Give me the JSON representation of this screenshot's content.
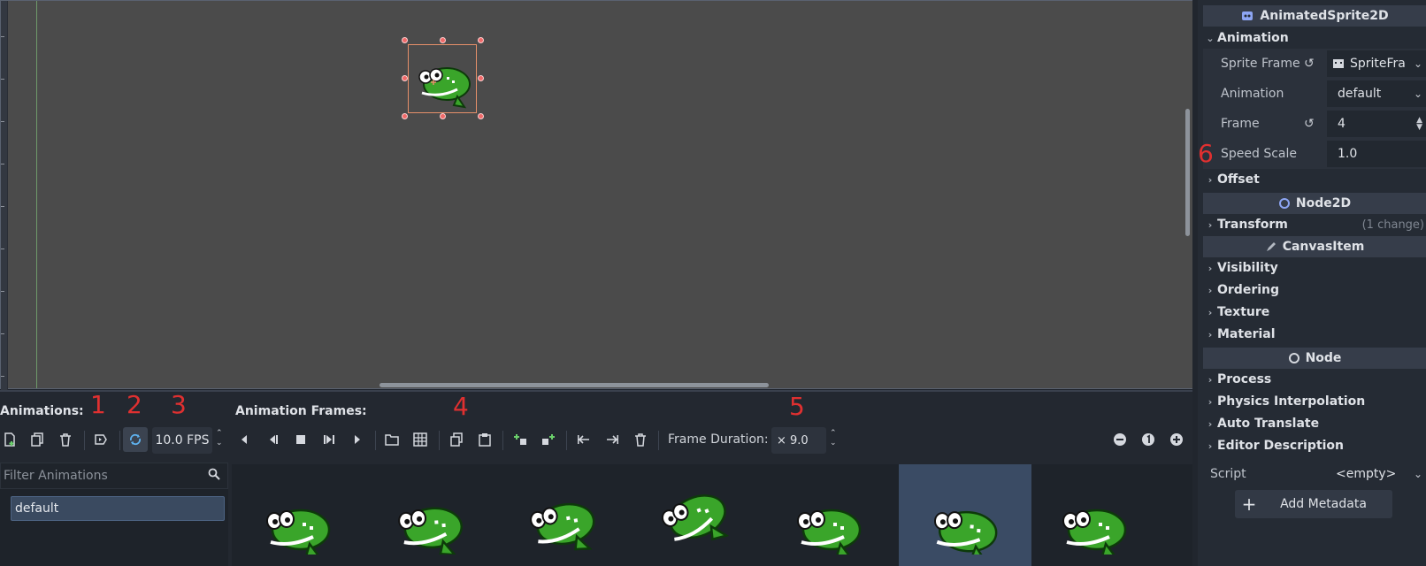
{
  "inspector": {
    "node_title": "AnimatedSprite2D",
    "section_animation": "Animation",
    "props": {
      "sprite_frames": {
        "label": "Sprite Frame",
        "value": "SpriteFra"
      },
      "animation": {
        "label": "Animation",
        "value": "default"
      },
      "frame": {
        "label": "Frame",
        "value": "4"
      },
      "speed_scale": {
        "label": "Speed Scale",
        "value": "1.0"
      }
    },
    "section_offset": "Offset",
    "header_node2d": "Node2D",
    "section_transform": "Transform",
    "transform_changes": "(1 change)",
    "header_canvasitem": "CanvasItem",
    "sections_canvasitem": [
      "Visibility",
      "Ordering",
      "Texture",
      "Material"
    ],
    "header_node": "Node",
    "sections_node": [
      "Process",
      "Physics Interpolation",
      "Auto Translate",
      "Editor Description"
    ],
    "script_label": "Script",
    "script_value": "<empty>",
    "add_metadata": "Add Metadata"
  },
  "bottom_panel": {
    "animations_label": "Animations:",
    "frames_label": "Animation Frames:",
    "fps_value": "10.0 FPS",
    "frame_duration_label": "Frame Duration:",
    "frame_duration_value": "× 9.0",
    "filter_placeholder": "Filter Animations",
    "animations": [
      "default"
    ],
    "frame_count": 7,
    "selected_frame": 5
  },
  "annotations": [
    "1",
    "2",
    "3",
    "4",
    "5",
    "6"
  ],
  "icons": {
    "toolbar": [
      "add-animation-icon",
      "duplicate-animation-icon",
      "delete-animation-icon",
      "autoplay-icon",
      "loop-icon",
      "play-backwards-icon",
      "play-backwards-from-start-icon",
      "stop-icon",
      "play-from-start-icon",
      "play-icon",
      "load-file-icon",
      "load-sheet-icon",
      "copy-icon",
      "paste-icon",
      "insert-before-icon",
      "insert-after-icon",
      "move-left-icon",
      "move-right-icon",
      "delete-frame-icon"
    ]
  },
  "colors": {
    "frog_green": "#3aa52a",
    "annotation_red": "#e03030",
    "selection": "#3a4b64"
  }
}
